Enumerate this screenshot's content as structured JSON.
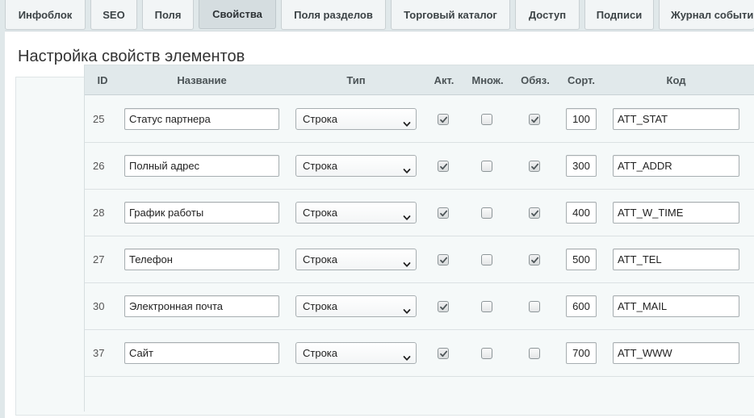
{
  "tabs": [
    {
      "label": "Инфоблок",
      "active": false
    },
    {
      "label": "SEO",
      "active": false
    },
    {
      "label": "Поля",
      "active": false
    },
    {
      "label": "Свойства",
      "active": true
    },
    {
      "label": "Поля разделов",
      "active": false
    },
    {
      "label": "Торговый каталог",
      "active": false
    },
    {
      "label": "Доступ",
      "active": false
    },
    {
      "label": "Подписи",
      "active": false
    },
    {
      "label": "Журнал событий",
      "active": false
    }
  ],
  "page_title": "Настройка свойств элементов",
  "table": {
    "columns": {
      "id": "ID",
      "name": "Название",
      "type": "Тип",
      "active": "Акт.",
      "multiple": "Множ.",
      "required": "Обяз.",
      "sort": "Сорт.",
      "code": "Код"
    },
    "rows": [
      {
        "id": "25",
        "name": "Статус партнера",
        "type": "Строка",
        "active": true,
        "multiple": false,
        "required": true,
        "sort": "100",
        "code": "ATT_STAT"
      },
      {
        "id": "26",
        "name": "Полный адрес",
        "type": "Строка",
        "active": true,
        "multiple": false,
        "required": true,
        "sort": "300",
        "code": "ATT_ADDR"
      },
      {
        "id": "28",
        "name": "График работы",
        "type": "Строка",
        "active": true,
        "multiple": false,
        "required": true,
        "sort": "400",
        "code": "ATT_W_TIME"
      },
      {
        "id": "27",
        "name": "Телефон",
        "type": "Строка",
        "active": true,
        "multiple": false,
        "required": true,
        "sort": "500",
        "code": "ATT_TEL"
      },
      {
        "id": "30",
        "name": "Электронная почта",
        "type": "Строка",
        "active": true,
        "multiple": false,
        "required": false,
        "sort": "600",
        "code": "ATT_MAIL"
      },
      {
        "id": "37",
        "name": "Сайт",
        "type": "Строка",
        "active": true,
        "multiple": false,
        "required": false,
        "sort": "700",
        "code": "ATT_WWW"
      }
    ]
  }
}
